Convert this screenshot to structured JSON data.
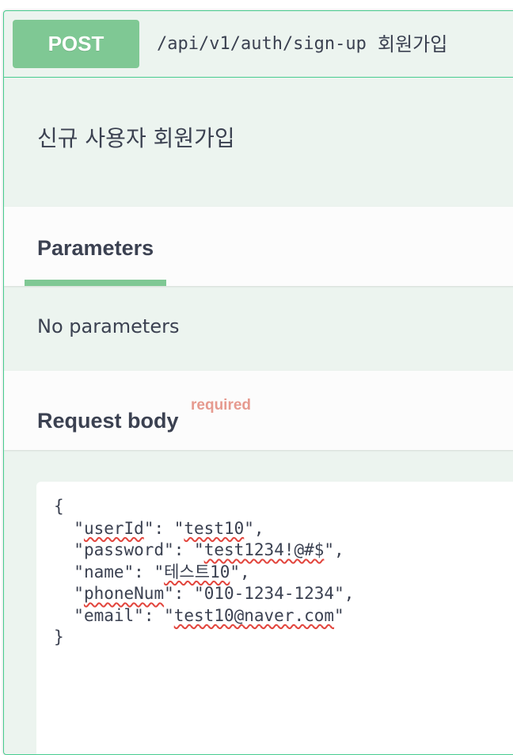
{
  "endpoint": {
    "method": "POST",
    "path": "/api/v1/auth/sign-up",
    "summary": "회원가입",
    "description": "신규 사용자 회원가입"
  },
  "parameters": {
    "tab_label": "Parameters",
    "empty_text": "No parameters"
  },
  "request_body": {
    "title": "Request body",
    "required_label": "required",
    "lines": {
      "open": "{",
      "l1_indent": "  ",
      "l1_q": "\"",
      "l1_key": "userId",
      "l1_mid": "\": \"",
      "l1_val": "test10",
      "l1_end": "\",",
      "l2_indent": "  ",
      "l2_q": "\"",
      "l2_key": "password",
      "l2_mid": "\": \"",
      "l2_val": "test1234!@#$",
      "l2_end": "\",",
      "l3_indent": "  ",
      "l3_q": "\"",
      "l3_key": "name",
      "l3_mid": "\": \"",
      "l3_val": "테스트10",
      "l3_end": "\",",
      "l4_indent": "  ",
      "l4_q": "\"",
      "l4_key": "phoneNum",
      "l4_mid": "\": \"",
      "l4_val": "010-1234-1234",
      "l4_end": "\",",
      "l5_indent": "  ",
      "l5_q": "\"",
      "l5_key": "email",
      "l5_mid": "\": \"",
      "l5_val": "test10@naver.com",
      "l5_end": "\"",
      "close": "}"
    }
  },
  "colors": {
    "post_method": "#7fc894",
    "post_border": "#49cc90",
    "block_bg": "#ecf4ef",
    "text": "#3b4151",
    "required": "#e69a8f",
    "spellcheck": "#e2453d"
  }
}
